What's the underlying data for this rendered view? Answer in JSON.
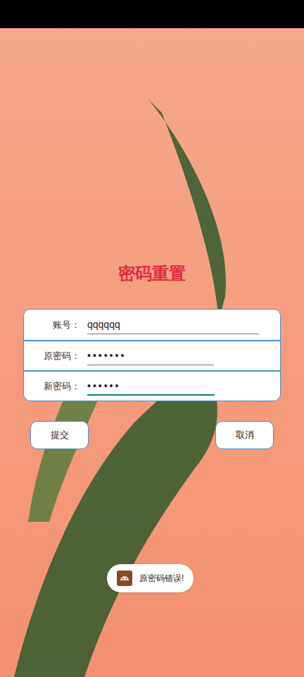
{
  "screen": {
    "title": "密码重置"
  },
  "form": {
    "fields": [
      {
        "label": "账号：",
        "value": "qqqqqq",
        "kind": "text",
        "focused": false
      },
      {
        "label": "原密码：",
        "value": "•••••••",
        "kind": "password",
        "focused": false
      },
      {
        "label": "新密码：",
        "value": "••••••",
        "kind": "password",
        "focused": true
      }
    ]
  },
  "buttons": [
    "提交",
    "取消"
  ],
  "toast": {
    "message": "原密码错误!"
  }
}
